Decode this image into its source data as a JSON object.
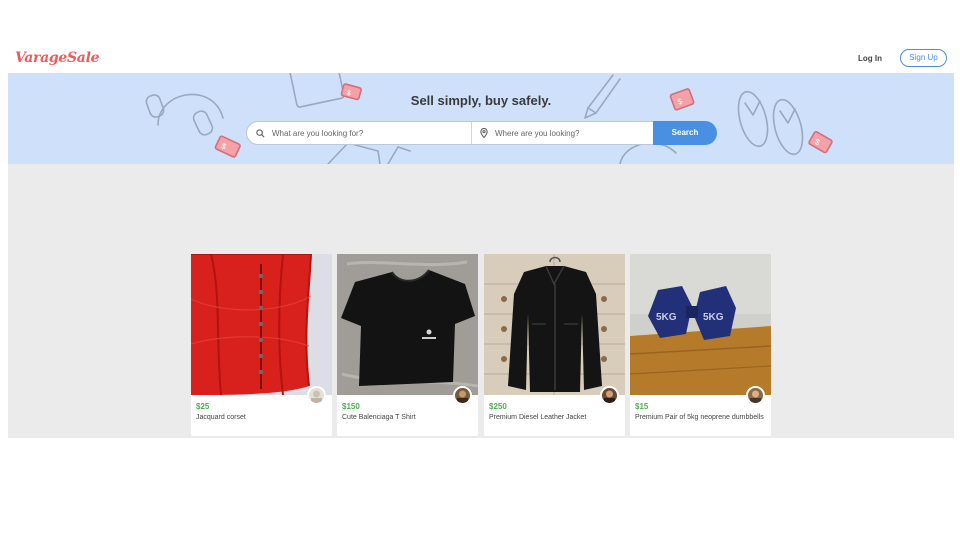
{
  "header": {
    "logo": "VarageSale",
    "login_label": "Log In",
    "signup_label": "Sign Up"
  },
  "hero": {
    "tagline": "Sell simply, buy safely.",
    "search": {
      "what_placeholder": "What are you looking for?",
      "where_placeholder": "Where are you looking?",
      "button_label": "Search"
    }
  },
  "listings": [
    {
      "price": "$25",
      "title": "Jacquard corset",
      "photo": "red-corset"
    },
    {
      "price": "$150",
      "title": "Cute Balenciaga T Shirt",
      "photo": "black-tshirt"
    },
    {
      "price": "$250",
      "title": "Premium Diesel Leather Jacket",
      "photo": "leather-jacket"
    },
    {
      "price": "$15",
      "title": "Premium Pair of 5kg neoprene dumbbells",
      "photo": "dumbbells",
      "dumbbell_label": "5KG"
    }
  ],
  "colors": {
    "brand": "#ef5a5a",
    "accent": "#4a90e2",
    "hero_bg": "#cfe0fb",
    "price": "#4caf50",
    "content_bg": "#ebebeb"
  }
}
